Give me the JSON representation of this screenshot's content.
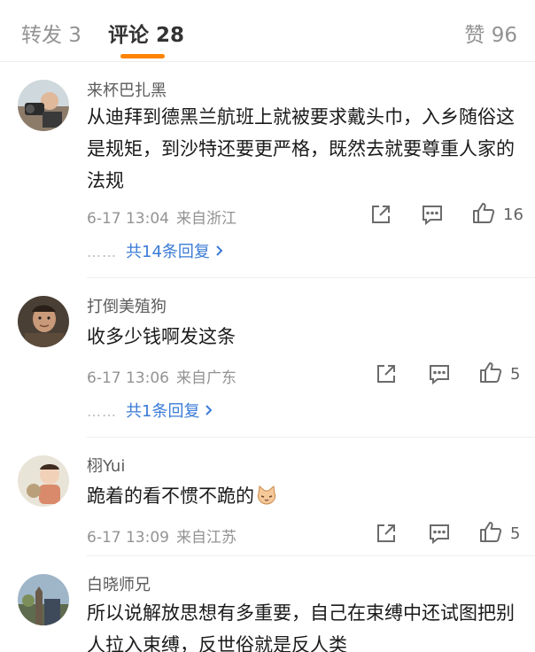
{
  "tabs": {
    "repost_label": "转发 3",
    "comments_label": "评论 28",
    "likes_label": "赞 96"
  },
  "colors": {
    "accent": "#ff8200",
    "link": "#3a7bd5"
  },
  "comments": [
    {
      "username": "来杯巴扎黑",
      "text": "从迪拜到德黑兰航班上就被要求戴头巾，入乡随俗这是规矩，到沙特还要更严格，既然去就要尊重人家的法规",
      "time": "6-17 13:04",
      "location": "来自浙江",
      "likes": "16",
      "replies": "共14条回复"
    },
    {
      "username": "打倒美殖狗",
      "text": "收多少钱啊发这条",
      "time": "6-17 13:06",
      "location": "来自广东",
      "likes": "5",
      "replies": "共1条回复"
    },
    {
      "username": "栩Yui",
      "text": "跪着的看不惯不跪的",
      "emoji": "cat-face-emoji",
      "time": "6-17 13:09",
      "location": "来自江苏",
      "likes": "5"
    },
    {
      "username": "白晓师兄",
      "text": "所以说解放思想有多重要，自己在束缚中还试图把别人拉入束缚，反世俗就是反人类"
    }
  ],
  "icons": {
    "share": "share-icon",
    "comment": "comment-icon",
    "like": "thumbs-up-icon",
    "chevron": "chevron-right-icon"
  }
}
